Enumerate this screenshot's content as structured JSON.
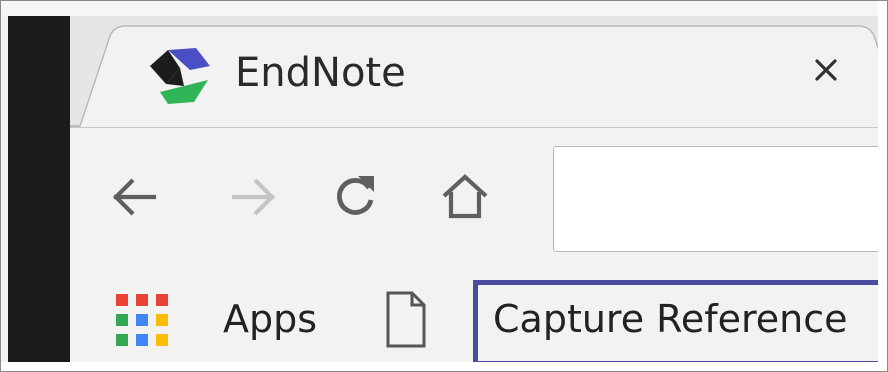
{
  "tab": {
    "title": "EndNote",
    "icon": "endnote-logo-icon",
    "close_glyph": "×"
  },
  "nav": {
    "back_icon": "arrow-left-icon",
    "forward_icon": "arrow-right-icon",
    "reload_icon": "reload-icon",
    "home_icon": "home-icon"
  },
  "address_bar": {
    "value": ""
  },
  "bookmarks": {
    "apps_label": "Apps",
    "items": [
      {
        "label": "Capture Reference",
        "icon": "page-icon",
        "highlighted": true
      }
    ]
  },
  "colors": {
    "highlight_border": "#4a4b9f",
    "logo_blue": "#4a4fc4",
    "logo_green": "#2fb457",
    "logo_dark": "#1c1c1c",
    "apps_grid": [
      "#e94336",
      "#fbbc05",
      "#34a853",
      "#4285f4"
    ]
  }
}
